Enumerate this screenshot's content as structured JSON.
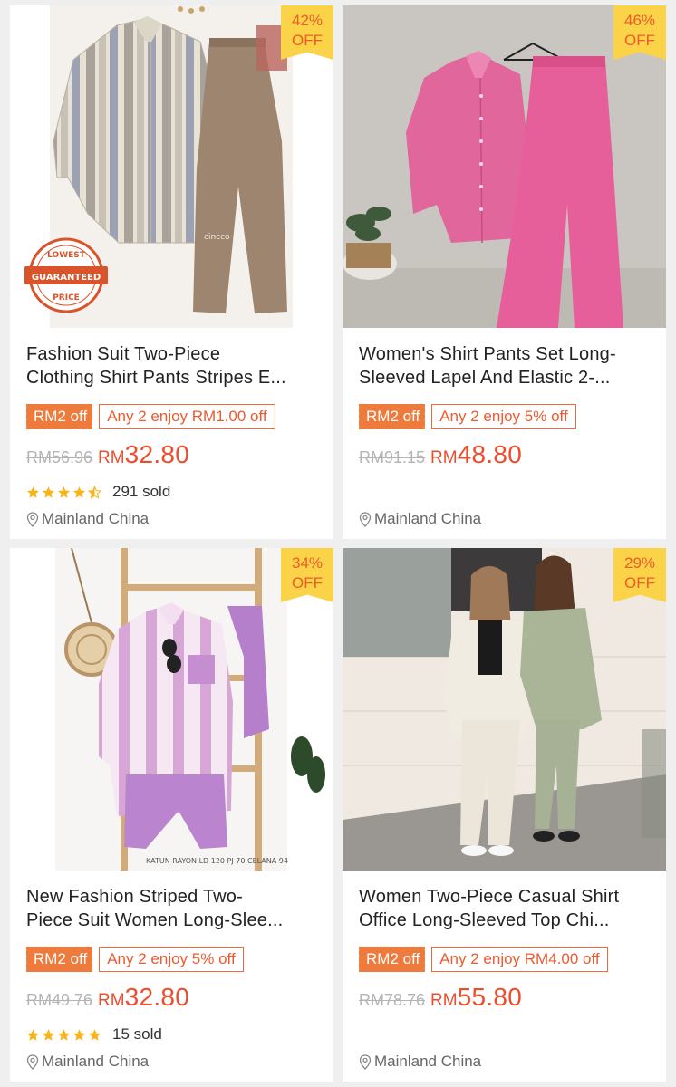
{
  "products": [
    {
      "discount_pct": "42%",
      "discount_label": "OFF",
      "title_line1": "Fashion Suit Two-Piece",
      "title_line2": "Clothing Shirt Pants Stripes E...",
      "promo_rm": "RM2 off",
      "promo_any": "Any 2 enjoy RM1.00 off",
      "original_price": "RM56.96",
      "currency": "RM",
      "price": "32.80",
      "rating_stars": 4.5,
      "sold": "291 sold",
      "location": "Mainland China",
      "image_badge": [
        "LOWEST",
        "GUARANTEED",
        "PRICE"
      ],
      "image_text": "cincco"
    },
    {
      "discount_pct": "46%",
      "discount_label": "OFF",
      "title_line1": "Women's Shirt Pants Set Long-",
      "title_line2": "Sleeved Lapel And Elastic 2-...",
      "promo_rm": "RM2 off",
      "promo_any": "Any 2 enjoy 5% off",
      "original_price": "RM91.15",
      "currency": "RM",
      "price": "48.80",
      "location": "Mainland China"
    },
    {
      "discount_pct": "34%",
      "discount_label": "OFF",
      "title_line1": "New Fashion Striped Two-",
      "title_line2": "Piece Suit Women Long-Slee...",
      "promo_rm": "RM2 off",
      "promo_any": "Any 2 enjoy 5% off",
      "original_price": "RM49.76",
      "currency": "RM",
      "price": "32.80",
      "rating_stars": 5,
      "sold": "15 sold",
      "location": "Mainland China",
      "image_text": "KATUN RAYON LD 120 PJ 70 CELANA 94"
    },
    {
      "discount_pct": "29%",
      "discount_label": "OFF",
      "title_line1": "Women Two-Piece Casual Shirt",
      "title_line2": "Office Long-Sleeved Top Chi...",
      "promo_rm": "RM2 off",
      "promo_any": "Any 2 enjoy RM4.00 off",
      "original_price": "RM78.76",
      "currency": "RM",
      "price": "55.80",
      "location": "Mainland China"
    }
  ],
  "colors": {
    "price": "#ee4d2d",
    "promo_tag": "#ee7a3c",
    "discount_bg": "#fbd348",
    "star": "#f7b318"
  }
}
